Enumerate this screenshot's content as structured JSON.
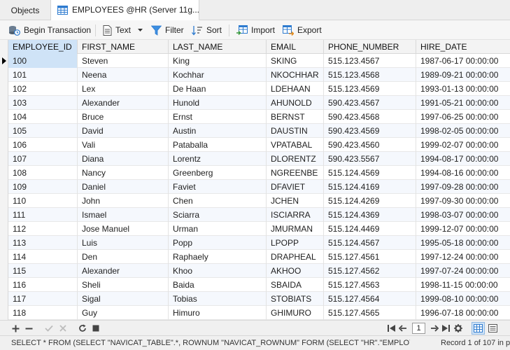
{
  "tabs": [
    {
      "label": "Objects"
    },
    {
      "label": "EMPLOYEES @HR (Server 11g..."
    }
  ],
  "toolbar": {
    "begin_transaction": "Begin Transaction",
    "text": "Text",
    "filter": "Filter",
    "sort": "Sort",
    "import": "Import",
    "export": "Export"
  },
  "columns": [
    "EMPLOYEE_ID",
    "FIRST_NAME",
    "LAST_NAME",
    "EMAIL",
    "PHONE_NUMBER",
    "HIRE_DATE"
  ],
  "rows": [
    [
      "100",
      "Steven",
      "King",
      "SKING",
      "515.123.4567",
      "1987-06-17 00:00:00"
    ],
    [
      "101",
      "Neena",
      "Kochhar",
      "NKOCHHAR",
      "515.123.4568",
      "1989-09-21 00:00:00"
    ],
    [
      "102",
      "Lex",
      "De Haan",
      "LDEHAAN",
      "515.123.4569",
      "1993-01-13 00:00:00"
    ],
    [
      "103",
      "Alexander",
      "Hunold",
      "AHUNOLD",
      "590.423.4567",
      "1991-05-21 00:00:00"
    ],
    [
      "104",
      "Bruce",
      "Ernst",
      "BERNST",
      "590.423.4568",
      "1997-06-25 00:00:00"
    ],
    [
      "105",
      "David",
      "Austin",
      "DAUSTIN",
      "590.423.4569",
      "1998-02-05 00:00:00"
    ],
    [
      "106",
      "Vali",
      "Pataballa",
      "VPATABAL",
      "590.423.4560",
      "1999-02-07 00:00:00"
    ],
    [
      "107",
      "Diana",
      "Lorentz",
      "DLORENTZ",
      "590.423.5567",
      "1994-08-17 00:00:00"
    ],
    [
      "108",
      "Nancy",
      "Greenberg",
      "NGREENBE",
      "515.124.4569",
      "1994-08-16 00:00:00"
    ],
    [
      "109",
      "Daniel",
      "Faviet",
      "DFAVIET",
      "515.124.4169",
      "1997-09-28 00:00:00"
    ],
    [
      "110",
      "John",
      "Chen",
      "JCHEN",
      "515.124.4269",
      "1997-09-30 00:00:00"
    ],
    [
      "111",
      "Ismael",
      "Sciarra",
      "ISCIARRA",
      "515.124.4369",
      "1998-03-07 00:00:00"
    ],
    [
      "112",
      "Jose Manuel",
      "Urman",
      "JMURMAN",
      "515.124.4469",
      "1999-12-07 00:00:00"
    ],
    [
      "113",
      "Luis",
      "Popp",
      "LPOPP",
      "515.124.4567",
      "1995-05-18 00:00:00"
    ],
    [
      "114",
      "Den",
      "Raphaely",
      "DRAPHEAL",
      "515.127.4561",
      "1997-12-24 00:00:00"
    ],
    [
      "115",
      "Alexander",
      "Khoo",
      "AKHOO",
      "515.127.4562",
      "1997-07-24 00:00:00"
    ],
    [
      "116",
      "Sheli",
      "Baida",
      "SBAIDA",
      "515.127.4563",
      "1998-11-15 00:00:00"
    ],
    [
      "117",
      "Sigal",
      "Tobias",
      "STOBIATS",
      "515.127.4564",
      "1999-08-10 00:00:00"
    ],
    [
      "118",
      "Guy",
      "Himuro",
      "GHIMURO",
      "515.127.4565",
      "1996-07-18 00:00:00"
    ]
  ],
  "navigation": {
    "page": "1"
  },
  "status": {
    "sql": "SELECT * FROM (SELECT \"NAVICAT_TABLE\".*, ROWNUM \"NAVICAT_ROWNUM\" FORM (SELECT \"HR\".\"EMPLOYEES\"",
    "record": "Record 1 of 107 in p"
  },
  "colors": {
    "accent_blue": "#2e7bcf",
    "selection": "#cfe3f7",
    "alt_row": "#f5f8fd"
  },
  "icons": [
    "table-icon",
    "transaction-icon",
    "text-icon",
    "filter-icon",
    "sort-icon",
    "import-icon",
    "export-icon",
    "add-icon",
    "remove-icon",
    "apply-icon",
    "discard-icon",
    "refresh-icon",
    "stop-icon",
    "first-page-icon",
    "prev-page-icon",
    "next-page-icon",
    "last-page-icon",
    "settings-icon",
    "grid-view-icon",
    "form-view-icon"
  ]
}
